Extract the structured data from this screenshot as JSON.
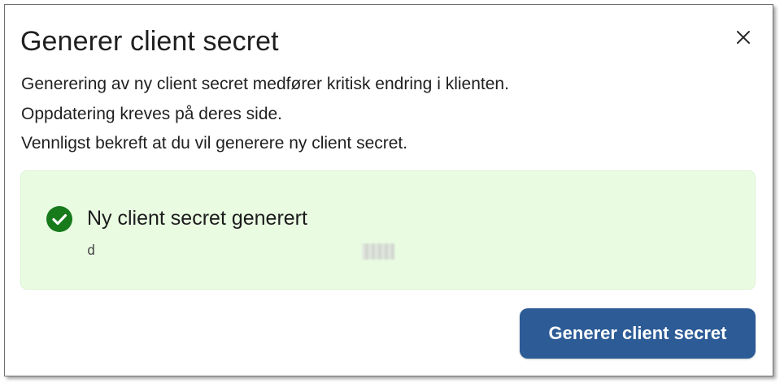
{
  "dialog": {
    "title": "Generer client secret",
    "close_icon": "close-icon",
    "description": [
      "Generering av ny client secret medfører kritisk endring i klienten.",
      "Oppdatering kreves på deres side.",
      "Vennligst bekreft at du vil generere ny client secret."
    ],
    "success": {
      "icon": "check-circle-icon",
      "title": "Ny client secret generert",
      "secret_value_visible": "d"
    },
    "confirm_button_label": "Generer client secret"
  },
  "colors": {
    "success_bg": "#e9fce2",
    "success_icon": "#177a1b",
    "primary_button": "#2c5b96"
  }
}
